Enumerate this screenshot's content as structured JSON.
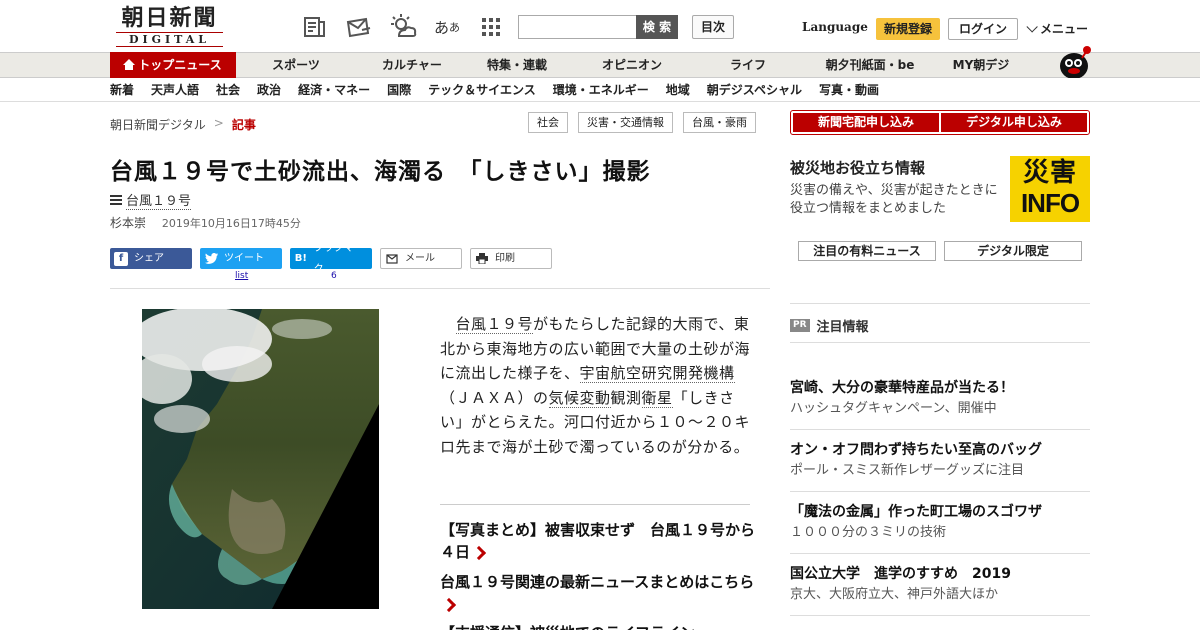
{
  "header": {
    "logo_jp": "朝日新聞",
    "logo_en": "DIGITAL",
    "aa_big": "あ",
    "aa_small": "あ",
    "search_button": "検 索",
    "mokuji": "目次",
    "language": "Language",
    "register": "新規登録",
    "login": "ログイン",
    "menu": "メニュー"
  },
  "nav1": [
    "トップニュース",
    "スポーツ",
    "カルチャー",
    "特集・連載",
    "オピニオン",
    "ライフ",
    "朝夕刊紙面・be",
    "MY朝デジ"
  ],
  "nav2": [
    "新着",
    "天声人語",
    "社会",
    "政治",
    "経済・マネー",
    "国際",
    "テック＆サイエンス",
    "環境・エネルギー",
    "地域",
    "朝デジスペシャル",
    "写真・動画"
  ],
  "breadcrumb": {
    "home": "朝日新聞デジタル",
    "sep": ">",
    "current": "記事"
  },
  "tags": [
    "社会",
    "災害・交通情報",
    "台風・豪雨"
  ],
  "article": {
    "headline": "台風１９号で土砂流出、海濁る　「しきさい」撮影",
    "series": "台風１９号",
    "author": "杉本崇",
    "date": "2019年10月16日17時45分",
    "body_pre": "　",
    "body_link1": "台風１９号",
    "body_mid1": "がもたらした記録的大雨で、東北から東海地方の広い範囲で大量の土砂が海に流出した様子を、",
    "body_link2": "宇宙航空研究開発機構",
    "body_mid2": "（ＪＡＸＡ）の",
    "body_link3": "気候変動",
    "body_mid3": "観測",
    "body_link4": "衛星",
    "body_end": "「しきさい」がとらえた。河口付近から１０～２０キロ先まで海が土砂で濁っているのが分かる。",
    "related1": "【写真まとめ】被害収束せず　台風１９号から４日",
    "related2": "台風１９号関連の最新ニュースまとめはこちら",
    "related3": "【支援通信】被災地でのライフライン"
  },
  "share": {
    "facebook": "シェア",
    "twitter": "ツイート",
    "hatena": "ブックマーク",
    "mail": "メール",
    "print": "印刷",
    "twitter_count": "list",
    "hatena_count": "6"
  },
  "right": {
    "sub1": "新聞宅配申し込み",
    "sub2": "デジタル申し込み",
    "saigai_title": "被災地お役立ち情報",
    "saigai_desc": "災害の備えや、災害が起きたときに役立つ情報をまとめました",
    "saigai_logo_a": "災害",
    "saigai_logo_b": "INFO",
    "btn1": "注目の有料ニュース",
    "btn2": "デジタル限定",
    "pr_badge": "PR",
    "pr_title": "注目情報",
    "items": [
      {
        "title": "宮崎、大分の豪華特産品が当たる！",
        "sub": "ハッシュタグキャンペーン、開催中"
      },
      {
        "title": "オン・オフ問わず持ちたい至高のバッグ",
        "sub": "ポール・スミス新作レザーグッズに注目"
      },
      {
        "title": "「魔法の金属」作った町工場のスゴワザ",
        "sub": "１０００分の３ミリの技術"
      },
      {
        "title": "国公立大学　進学のすすめ　2019",
        "sub": "京大、大阪府立大、神戸外語大ほか"
      }
    ]
  },
  "colors": {
    "brand_red": "#bb0000",
    "register_yellow": "#f6c23c",
    "saigai_yellow": "#f6d200"
  }
}
